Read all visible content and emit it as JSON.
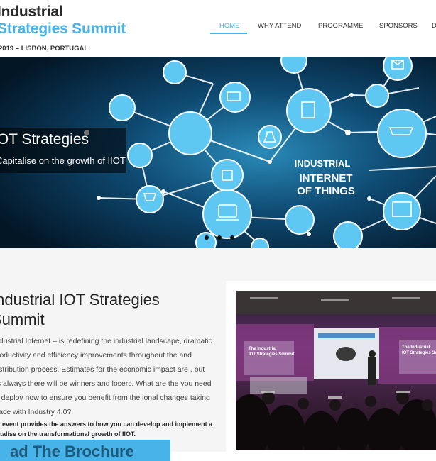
{
  "header": {
    "logo_line1": "Industrial",
    "logo_line2": "Strategies Summit",
    "event_meta": "2019 – LISBON, PORTUGAL"
  },
  "nav": {
    "items": [
      {
        "label": "HOME",
        "active": true
      },
      {
        "label": "WHY ATTEND",
        "active": false
      },
      {
        "label": "PROGRAMME",
        "active": false
      },
      {
        "label": "SPONSORS",
        "active": false
      },
      {
        "label": "D",
        "active": false
      }
    ]
  },
  "hero": {
    "caption_title": "IOT Strategies",
    "caption_subtitle": "Capitalise on the growth of IIOT",
    "graphic_line1": "INDUSTRIAL",
    "graphic_line2": "INTERNET",
    "graphic_line3": "OF THINGS",
    "active_slide": 1,
    "slide_count": 2
  },
  "intro": {
    "title": "Industrial IOT Strategies Summit",
    "paragraph": "Industrial Internet – is redefining the industrial landscape, dramatic productivity and efficiency improvements throughout the and distribution process. Estimates for the economic impact are , but as always there will be winners and losers. What are the you need to deploy now to ensure you benefit from the ional changes taking place with Industry 4.0?",
    "bold_text": "nt event provides the answers to how you can develop and implement a pitalise on the transformational growth of IIOT.",
    "cta_label": "ad The Brochure"
  },
  "photo": {
    "screen_title_left": "The Industrial IOT Strategies Summit",
    "screen_title_right": "The Industrial IOT Strategies Summit"
  },
  "colors": {
    "accent": "#48b3e8",
    "hero_bg": "#06223a",
    "content_bg": "#f5f5f5"
  }
}
